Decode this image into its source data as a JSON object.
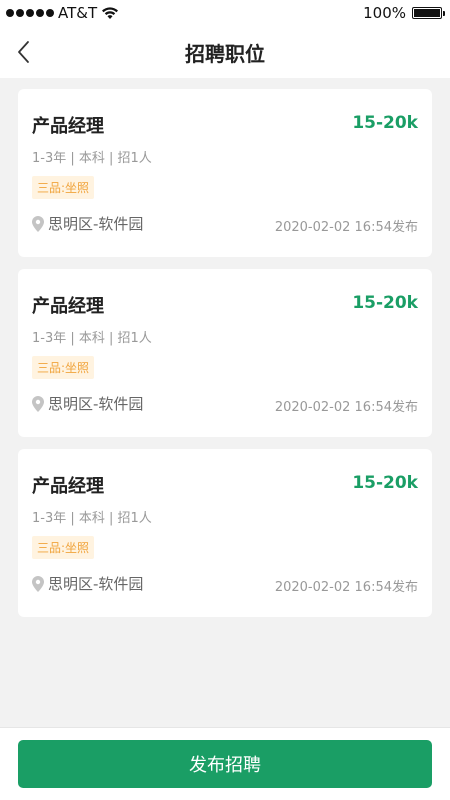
{
  "status_bar": {
    "carrier": "AT&T",
    "battery_percent": "100%",
    "battery_level": 1.0
  },
  "nav": {
    "title": "招聘职位",
    "back_icon": "chevron-left-icon"
  },
  "jobs": [
    {
      "title": "产品经理",
      "salary": "15-20k",
      "requirements": "1-3年 | 本科 | 招1人",
      "tag": "三品:坐照",
      "location": "思明区-软件园",
      "published": "2020-02-02 16:54发布"
    },
    {
      "title": "产品经理",
      "salary": "15-20k",
      "requirements": "1-3年 | 本科 | 招1人",
      "tag": "三品:坐照",
      "location": "思明区-软件园",
      "published": "2020-02-02 16:54发布"
    },
    {
      "title": "产品经理",
      "salary": "15-20k",
      "requirements": "1-3年 | 本科 | 招1人",
      "tag": "三品:坐照",
      "location": "思明区-软件园",
      "published": "2020-02-02 16:54发布"
    }
  ],
  "bottom": {
    "publish_label": "发布招聘"
  },
  "colors": {
    "accent": "#1a9e65",
    "tag_bg": "#fff3e0",
    "tag_text": "#f0a43c"
  }
}
